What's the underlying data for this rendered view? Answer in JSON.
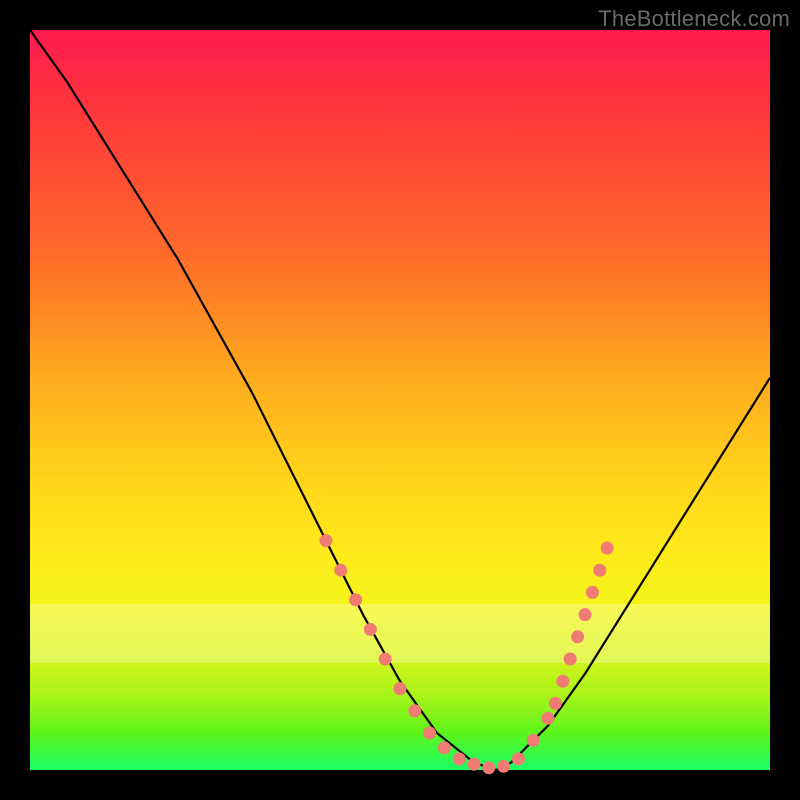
{
  "watermark": "TheBottleneck.com",
  "chart_data": {
    "type": "line",
    "title": "",
    "xlabel": "",
    "ylabel": "",
    "xlim": [
      0,
      100
    ],
    "ylim": [
      0,
      100
    ],
    "grid": false,
    "legend": false,
    "background_gradient": {
      "direction": "vertical",
      "stops": [
        {
          "pos": 0.0,
          "color": "#ff1a4d"
        },
        {
          "pos": 0.3,
          "color": "#ff6a2a"
        },
        {
          "pos": 0.6,
          "color": "#ffd21a"
        },
        {
          "pos": 0.8,
          "color": "#f4f41a"
        },
        {
          "pos": 0.95,
          "color": "#5cf41a"
        },
        {
          "pos": 1.0,
          "color": "#1aff66"
        }
      ]
    },
    "pale_highlight_band": {
      "y_top": 78,
      "y_bottom": 85,
      "color": "#ffffcc",
      "opacity": 0.35
    },
    "series": [
      {
        "name": "bottleneck-curve",
        "color": "#000000",
        "x": [
          0,
          5,
          10,
          15,
          20,
          25,
          30,
          35,
          40,
          45,
          50,
          55,
          60,
          63,
          65,
          70,
          75,
          80,
          85,
          90,
          95,
          100
        ],
        "y": [
          100,
          93,
          85,
          77,
          69,
          60,
          51,
          41,
          31,
          21,
          12,
          5,
          1,
          0,
          1,
          6,
          13,
          21,
          29,
          37,
          45,
          53
        ]
      }
    ],
    "markers": {
      "name": "highlighted-points",
      "color": "#ef7b73",
      "points": [
        {
          "x": 40,
          "y": 31
        },
        {
          "x": 42,
          "y": 27
        },
        {
          "x": 44,
          "y": 23
        },
        {
          "x": 46,
          "y": 19
        },
        {
          "x": 48,
          "y": 15
        },
        {
          "x": 50,
          "y": 11
        },
        {
          "x": 52,
          "y": 8
        },
        {
          "x": 54,
          "y": 5
        },
        {
          "x": 56,
          "y": 3
        },
        {
          "x": 58,
          "y": 1.5
        },
        {
          "x": 60,
          "y": 0.8
        },
        {
          "x": 62,
          "y": 0.3
        },
        {
          "x": 64,
          "y": 0.5
        },
        {
          "x": 66,
          "y": 1.5
        },
        {
          "x": 68,
          "y": 4
        },
        {
          "x": 70,
          "y": 7
        },
        {
          "x": 71,
          "y": 9
        },
        {
          "x": 72,
          "y": 12
        },
        {
          "x": 73,
          "y": 15
        },
        {
          "x": 74,
          "y": 18
        },
        {
          "x": 75,
          "y": 21
        },
        {
          "x": 76,
          "y": 24
        },
        {
          "x": 77,
          "y": 27
        },
        {
          "x": 78,
          "y": 30
        }
      ]
    }
  }
}
